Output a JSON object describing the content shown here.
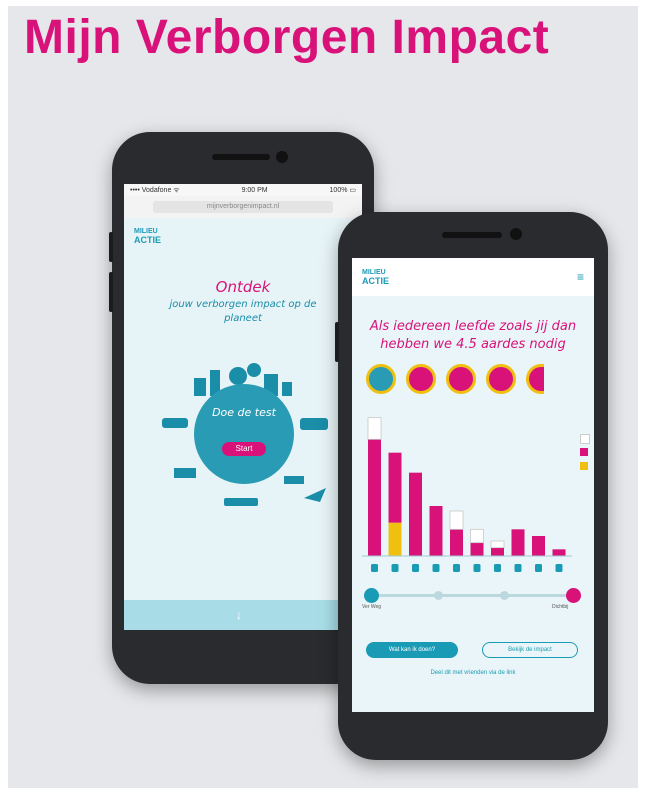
{
  "title": "Mijn Verborgen Impact",
  "colors": {
    "accent": "#d9127a",
    "teal": "#1a9bb5",
    "yellow": "#f0c010"
  },
  "phone1": {
    "status": {
      "carrier": "•••• Vodafone ᯤ",
      "time": "9:00 PM",
      "battery": "100% ▭"
    },
    "url": "mijnverborgenimpact.nl",
    "logo": [
      "MILIEU",
      "ACTIE"
    ],
    "heading": "Ontdek",
    "subheading": "jouw verborgen impact op de planeet",
    "globe_text": "Doe de test",
    "start_button": "Start",
    "scroll_icon": "arrow-down-icon",
    "glyph": "↓"
  },
  "phone2": {
    "logo": [
      "MILIEU",
      "ACTIE"
    ],
    "menu_icon": "hamburger-icon",
    "menu_glyph": "≡",
    "headline": "Als iedereen leefde zoals jij dan hebben we 4.5 aardes nodig",
    "earths": 5,
    "chart_data": {
      "type": "bar",
      "categories": [
        "phone",
        "car",
        "food",
        "pants",
        "plane",
        "shirt",
        "house",
        "meat",
        "bus",
        "train"
      ],
      "series": [
        {
          "name": "",
          "values": [
            13,
            0,
            0,
            0,
            0,
            0,
            0,
            0,
            0,
            0
          ],
          "color": "#ffffff"
        },
        {
          "name": "",
          "values": [
            70,
            42,
            50,
            30,
            16,
            8,
            5,
            16,
            12,
            4
          ],
          "color": "#d9127a"
        },
        {
          "name": "",
          "values": [
            0,
            20,
            0,
            0,
            0,
            0,
            0,
            0,
            0,
            0
          ],
          "color": "#f0c010"
        }
      ],
      "outline_tops": [
        0,
        0,
        0,
        0,
        11,
        8,
        4,
        0,
        0,
        0
      ],
      "ylim": [
        0,
        90
      ]
    },
    "slider": {
      "left_label": "Ver Weg",
      "right_label": "Dichtbij",
      "level": 1.0
    },
    "button_primary": "Wat kan ik doen?",
    "button_secondary": "Bekijk de impact",
    "footnote": "Deel dit met vrienden via de link"
  }
}
